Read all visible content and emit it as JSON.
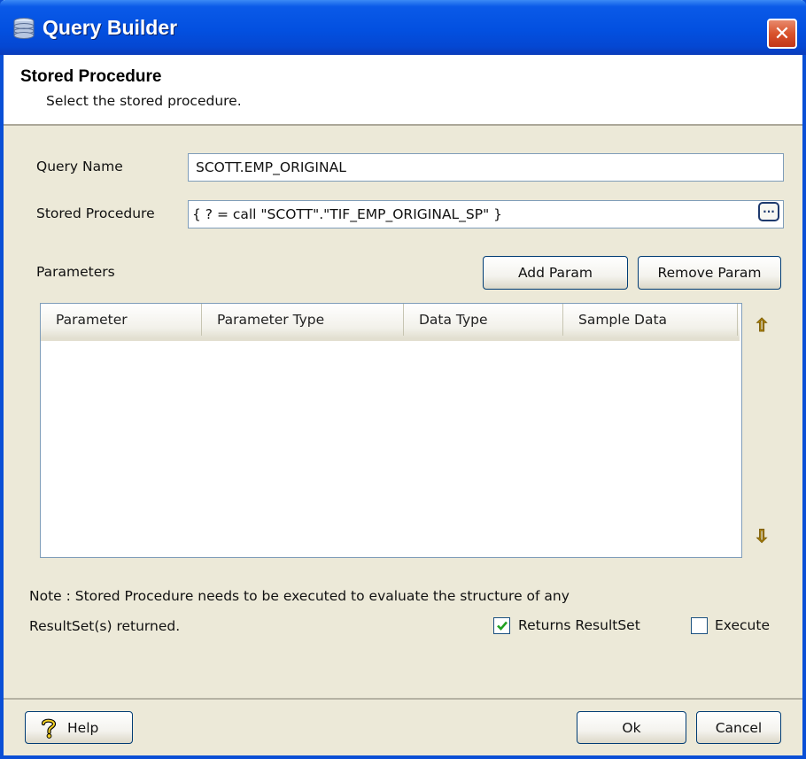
{
  "window": {
    "title": "Query Builder",
    "close_label": "✕"
  },
  "header": {
    "title": "Stored Procedure",
    "subtitle": "Select the stored procedure."
  },
  "form": {
    "query_name_label": "Query Name",
    "query_name_value": "SCOTT.EMP_ORIGINAL",
    "stored_procedure_label": "Stored Procedure",
    "stored_procedure_value": "{ ? = call \"SCOTT\".\"TIF_EMP_ORIGINAL_SP\" }",
    "browse_label": "···"
  },
  "parameters": {
    "label": "Parameters",
    "add_button": "Add Param",
    "remove_button": "Remove Param",
    "columns": [
      "Parameter",
      "Parameter Type",
      "Data Type",
      "Sample Data"
    ],
    "rows": [],
    "move_up_icon": "⇧",
    "move_down_icon": "⇩"
  },
  "note": {
    "line1": "Note : Stored Procedure needs to be executed to evaluate the structure of any",
    "line2": "ResultSet(s) returned."
  },
  "options": {
    "returns_resultset_label": "Returns ResultSet",
    "returns_resultset_checked": true,
    "execute_label": "Execute",
    "execute_checked": false
  },
  "footer": {
    "help_label": "Help",
    "ok_label": "Ok",
    "cancel_label": "Cancel"
  },
  "colors": {
    "titlebar": "#0350e0",
    "dialog_bg": "#ece9d8",
    "checkmark": "#21a121"
  }
}
